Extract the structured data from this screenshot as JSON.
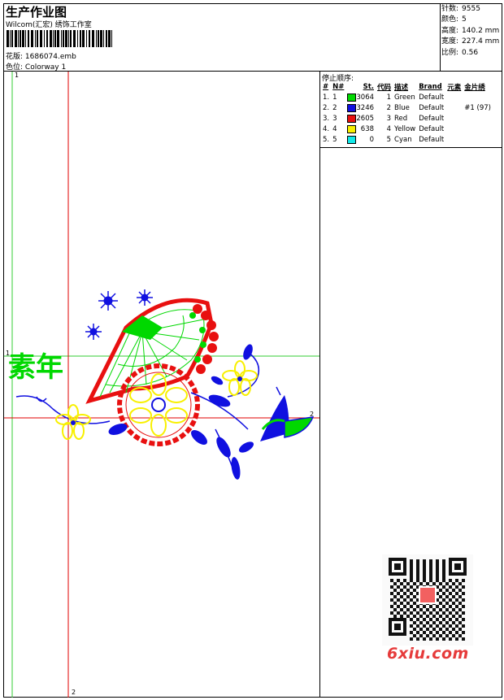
{
  "header": {
    "title": "生产作业图",
    "software": "Wilcom(汇宏) 绣饰工作室",
    "design_label": "花版:",
    "design_file": "1686074.emb",
    "colorway_label": "色位:",
    "colorway": "Colorway 1"
  },
  "stats": [
    {
      "label": "针数:",
      "value": "9555"
    },
    {
      "label": "颜色:",
      "value": "5"
    },
    {
      "label": "高度:",
      "value": "140.2 mm"
    },
    {
      "label": "宽度:",
      "value": "227.4 mm"
    },
    {
      "label": "比例:",
      "value": "0.56"
    }
  ],
  "stop_sequence": {
    "title": "停止顺序:",
    "columns": [
      "#",
      "N#",
      "St.",
      "代码",
      "描述",
      "Brand",
      "元素",
      "金片绣"
    ],
    "rows": [
      {
        "idx": "1.",
        "n": "1",
        "color": "#00d800",
        "stitches": "3064",
        "code": "1",
        "desc": "Green",
        "brand": "Default",
        "elem": "",
        "seq": ""
      },
      {
        "idx": "2.",
        "n": "2",
        "color": "#1010e0",
        "stitches": "3246",
        "code": "2",
        "desc": "Blue",
        "brand": "Default",
        "elem": "",
        "seq": "#1 (97)"
      },
      {
        "idx": "3.",
        "n": "3",
        "color": "#e81010",
        "stitches": "2605",
        "code": "3",
        "desc": "Red",
        "brand": "Default",
        "elem": "",
        "seq": ""
      },
      {
        "idx": "4.",
        "n": "4",
        "color": "#f8f000",
        "stitches": "638",
        "code": "4",
        "desc": "Yellow",
        "brand": "Default",
        "elem": "",
        "seq": ""
      },
      {
        "idx": "5.",
        "n": "5",
        "color": "#10e8e8",
        "stitches": "0",
        "code": "5",
        "desc": "Cyan",
        "brand": "Default",
        "elem": "",
        "seq": ""
      }
    ]
  },
  "guides": {
    "green_v": "1",
    "green_h": "1",
    "red_h": "2",
    "red_v": "2"
  },
  "design_text": "素年",
  "watermark": "6xiu.com",
  "colors": {
    "green": "#00d800",
    "blue": "#1010e0",
    "red": "#e81010",
    "yellow": "#f8f000",
    "guide_green": "#33cc33",
    "guide_red": "#e00000"
  }
}
